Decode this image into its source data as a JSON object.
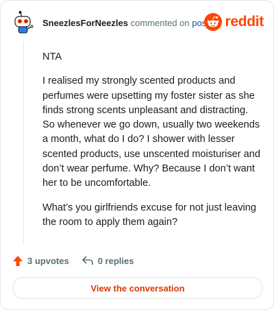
{
  "header": {
    "author": "SneezlesForNeezles",
    "action_text": "commented on",
    "post_link": "post",
    "brand_word": "reddit",
    "brand_color": "#ff4500"
  },
  "comment": {
    "paragraphs": [
      "NTA",
      "I realised my strongly scented products and perfumes were upsetting my foster sister as she finds strong scents unpleasant and distracting. So whenever we go down, usually two weekends a month, what do I do? I shower with lesser scented products, use unscented moisturiser and don’t wear perfume. Why? Because I don’t want her to be uncomfortable.",
      "What’s you girlfriends excuse for not just leaving the room to apply them again?"
    ]
  },
  "actions": {
    "upvotes_label": "3 upvotes",
    "replies_label": "0 replies",
    "upvote_icon": "upvote-arrow-icon",
    "reply_icon": "reply-arrow-icon"
  },
  "cta": {
    "label": "View the conversation"
  }
}
